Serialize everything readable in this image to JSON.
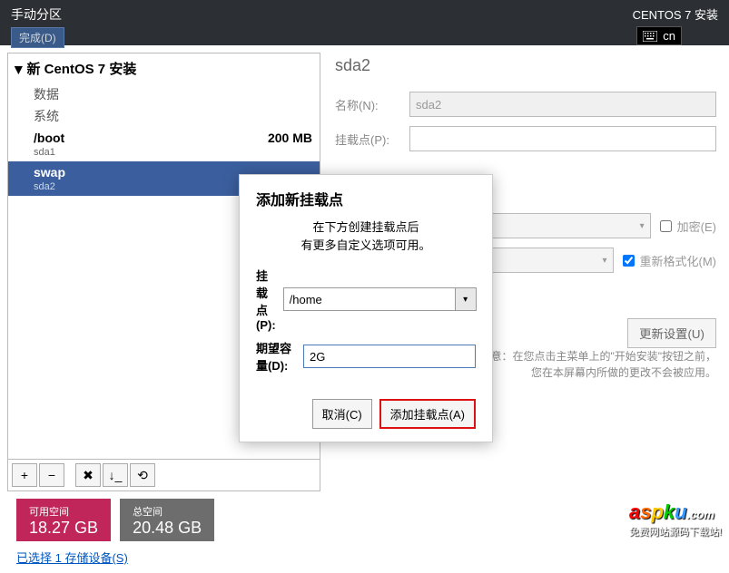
{
  "header": {
    "title": "手动分区",
    "done": "完成(D)",
    "install": "CENTOS 7 安装",
    "keyboard": "cn"
  },
  "tree": {
    "root": "新 CentOS 7 安装",
    "cat1": "数据",
    "cat2": "系统",
    "partitions": [
      {
        "name": "/boot",
        "dev": "sda1",
        "size": "200 MB",
        "selected": false
      },
      {
        "name": "swap",
        "dev": "sda2",
        "size": "",
        "selected": true
      }
    ]
  },
  "toolbar": {
    "add": "+",
    "remove": "−"
  },
  "right": {
    "title": "sda2",
    "name_label": "名称(N):",
    "name_value": "sda2",
    "mount_label": "挂载点(P):",
    "mount_value": "",
    "encrypt": "加密(E)",
    "reformat": "重新格式化(M)",
    "update": "更新设置(U)",
    "note1": "注意：在您点击主菜单上的\"开始安装\"按钮之前，",
    "note2": "您在本屏幕内所做的更改不会被应用。"
  },
  "footer": {
    "avail_label": "可用空间",
    "avail_value": "18.27 GB",
    "total_label": "总空间",
    "total_value": "20.48 GB",
    "storage_link": "已选择 1 存储设备(S)"
  },
  "modal": {
    "title": "添加新挂载点",
    "line1": "在下方创建挂载点后",
    "line2": "有更多自定义选项可用。",
    "mount_label": "挂载点(P):",
    "mount_value": "/home",
    "size_label": "期望容量(D):",
    "size_value": "2G",
    "cancel": "取消(C)",
    "add": "添加挂载点(A)"
  },
  "watermark": {
    "tagline": "免费网站源码下载站!"
  }
}
